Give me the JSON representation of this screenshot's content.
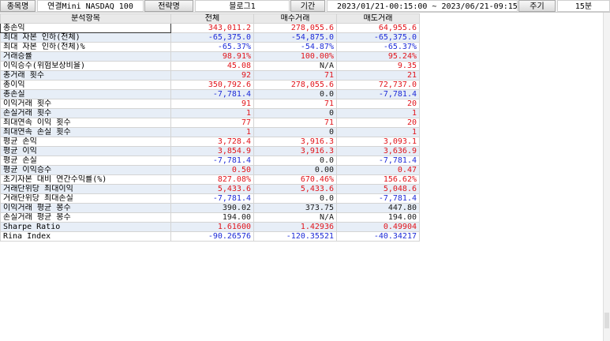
{
  "toolbar": {
    "item_label": "종목명",
    "item_value": "연결Mini NASDAQ 100",
    "strategy_label": "전략명",
    "strategy_value": "블로그1",
    "period_label": "기간",
    "period_value": "2023/01/21-00:15:00 ~ 2023/06/21-09:15:00",
    "cycle_label": "주기",
    "cycle_value": "15분"
  },
  "table": {
    "headers": [
      "분석항목",
      "전체",
      "매수거래",
      "매도거래"
    ],
    "rows": [
      {
        "name": "총손익",
        "all": "343,011.2",
        "buy": "278,055.6",
        "sell": "64,955.6",
        "c": [
          "red",
          "red",
          "red"
        ]
      },
      {
        "name": "최대 자본 인하(전체)",
        "all": "-65,375.0",
        "buy": "-54,875.0",
        "sell": "-65,375.0",
        "c": [
          "blue",
          "blue",
          "blue"
        ]
      },
      {
        "name": "최대 자본 인하(전체)%",
        "all": "-65.37%",
        "buy": "-54.87%",
        "sell": "-65.37%",
        "c": [
          "blue",
          "blue",
          "blue"
        ]
      },
      {
        "name": "거래승률",
        "all": "98.91%",
        "buy": "100.00%",
        "sell": "95.24%",
        "c": [
          "red",
          "red",
          "red"
        ]
      },
      {
        "name": "이익승수(위험보상비율)",
        "all": "45.08",
        "buy": "N/A",
        "sell": "9.35",
        "c": [
          "red",
          "blk",
          "red"
        ]
      },
      {
        "name": "총거래 횟수",
        "all": "92",
        "buy": "71",
        "sell": "21",
        "c": [
          "red",
          "red",
          "red"
        ]
      },
      {
        "name": "총이익",
        "all": "350,792.6",
        "buy": "278,055.6",
        "sell": "72,737.0",
        "c": [
          "red",
          "red",
          "red"
        ]
      },
      {
        "name": "총손실",
        "all": "-7,781.4",
        "buy": "0.0",
        "sell": "-7,781.4",
        "c": [
          "blue",
          "blk",
          "blue"
        ]
      },
      {
        "name": "이익거래 횟수",
        "all": "91",
        "buy": "71",
        "sell": "20",
        "c": [
          "red",
          "red",
          "red"
        ]
      },
      {
        "name": "손실거래 횟수",
        "all": "1",
        "buy": "0",
        "sell": "1",
        "c": [
          "red",
          "blk",
          "red"
        ]
      },
      {
        "name": "최대연속 이익 횟수",
        "all": "77",
        "buy": "71",
        "sell": "20",
        "c": [
          "red",
          "red",
          "red"
        ]
      },
      {
        "name": "최대연속 손실 횟수",
        "all": "1",
        "buy": "0",
        "sell": "1",
        "c": [
          "red",
          "blk",
          "red"
        ]
      },
      {
        "name": "평균 손익",
        "all": "3,728.4",
        "buy": "3,916.3",
        "sell": "3,093.1",
        "c": [
          "red",
          "red",
          "red"
        ]
      },
      {
        "name": "평균 이익",
        "all": "3,854.9",
        "buy": "3,916.3",
        "sell": "3,636.9",
        "c": [
          "red",
          "red",
          "red"
        ]
      },
      {
        "name": "평균 손실",
        "all": "-7,781.4",
        "buy": "0.0",
        "sell": "-7,781.4",
        "c": [
          "blue",
          "blk",
          "blue"
        ]
      },
      {
        "name": "평균 이익승수",
        "all": "0.50",
        "buy": "0.00",
        "sell": "0.47",
        "c": [
          "red",
          "blk",
          "red"
        ]
      },
      {
        "name": "초기자본 대비 연간수익률(%)",
        "all": "827.08%",
        "buy": "670.46%",
        "sell": "156.62%",
        "c": [
          "red",
          "red",
          "red"
        ]
      },
      {
        "name": "거래단위당 최대이익",
        "all": "5,433.6",
        "buy": "5,433.6",
        "sell": "5,048.6",
        "c": [
          "red",
          "red",
          "red"
        ]
      },
      {
        "name": "거래단위당 최대손실",
        "all": "-7,781.4",
        "buy": "0.0",
        "sell": "-7,781.4",
        "c": [
          "blue",
          "blk",
          "blue"
        ]
      },
      {
        "name": "이익거래 평균 봉수",
        "all": "390.02",
        "buy": "373.75",
        "sell": "447.80",
        "c": [
          "blk",
          "blk",
          "blk"
        ]
      },
      {
        "name": "손실거래 평균 봉수",
        "all": "194.00",
        "buy": "N/A",
        "sell": "194.00",
        "c": [
          "blk",
          "blk",
          "blk"
        ]
      },
      {
        "name": "Sharpe Ratio",
        "all": "1.61600",
        "buy": "1.42936",
        "sell": "0.49904",
        "c": [
          "red",
          "red",
          "red"
        ]
      },
      {
        "name": "Rina Index",
        "all": "-90.26576",
        "buy": "-120.35521",
        "sell": "-40.34217",
        "c": [
          "blue",
          "blue",
          "blue"
        ]
      }
    ]
  }
}
